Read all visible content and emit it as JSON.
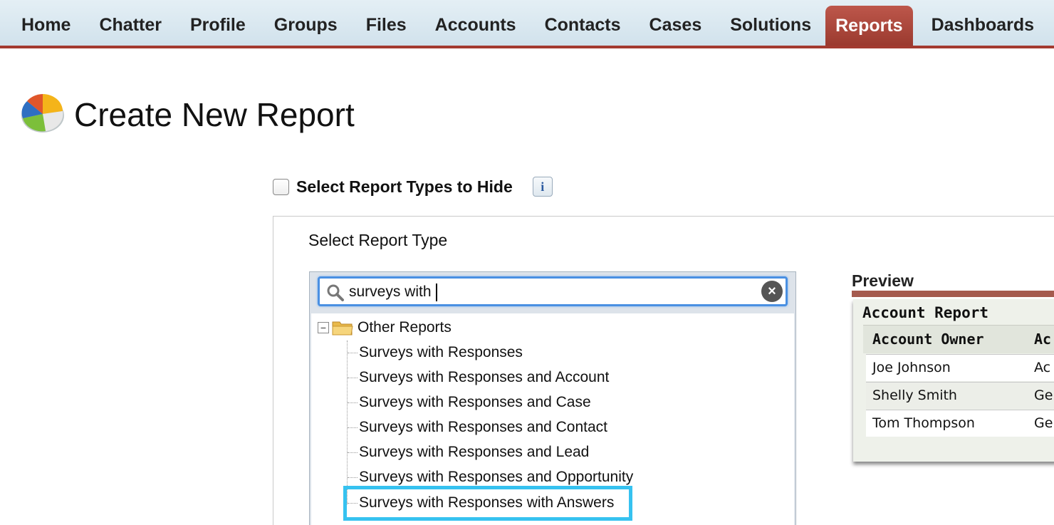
{
  "nav": {
    "tabs": [
      {
        "label": "Home"
      },
      {
        "label": "Chatter"
      },
      {
        "label": "Profile"
      },
      {
        "label": "Groups"
      },
      {
        "label": "Files"
      },
      {
        "label": "Accounts"
      },
      {
        "label": "Contacts"
      },
      {
        "label": "Cases"
      },
      {
        "label": "Solutions"
      },
      {
        "label": "Reports",
        "active": true
      },
      {
        "label": "Dashboards"
      }
    ]
  },
  "header": {
    "title": "Create New Report",
    "icon": "report-pie-chart-icon"
  },
  "hide_types": {
    "label": "Select Report Types to Hide",
    "checked": false,
    "info_icon": "info-icon",
    "info_glyph": "i"
  },
  "report_type": {
    "label": "Select Report Type",
    "search": {
      "value": "surveys with",
      "icons": [
        "search-icon",
        "clear-icon"
      ]
    },
    "tree": {
      "folder_label": "Other Reports",
      "items": [
        "Surveys with Responses",
        "Surveys with Responses and Account",
        "Surveys with Responses and Case",
        "Surveys with Responses and Contact",
        "Surveys with Responses and Lead",
        "Surveys with Responses and Opportunity",
        "Surveys with Responses with Answers"
      ],
      "highlighted_item": "Surveys with Responses with Answers"
    }
  },
  "preview": {
    "title": "Preview",
    "report_name": "Account Report",
    "columns": [
      "Account  Owner",
      "Ac"
    ],
    "rows": [
      [
        "Joe Johnson",
        "Ac"
      ],
      [
        "Shelly Smith",
        "Ge"
      ],
      [
        "Tom Thompson",
        "Ge"
      ]
    ]
  },
  "colors": {
    "active_tab": "#a8463b",
    "nav_bg": "#dbe8f0",
    "highlight": "#36c2f0",
    "search_focus": "#4a90e2"
  }
}
